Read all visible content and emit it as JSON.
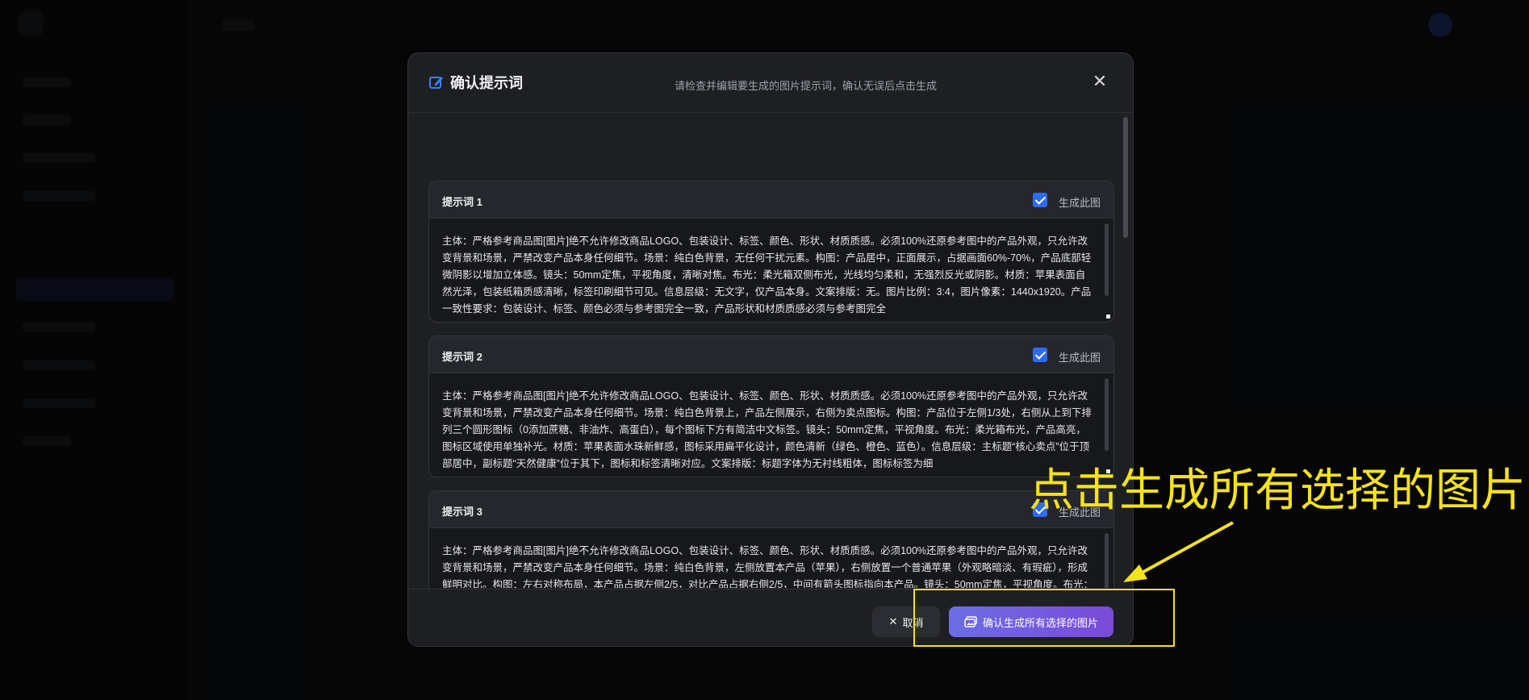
{
  "modal": {
    "title": "确认提示词",
    "subtitle": "请检查并编辑要生成的图片提示词，确认无误后点击生成",
    "close_glyph": "✕"
  },
  "prompts": [
    {
      "title": "提示词 1",
      "checked": true,
      "check_label": "生成此图",
      "text": "主体：严格参考商品图[图片]绝不允许修改商品LOGO、包装设计、标签、颜色、形状、材质质感。必须100%还原参考图中的产品外观，只允许改变背景和场景，严禁改变产品本身任何细节。场景：纯白色背景，无任何干扰元素。构图：产品居中，正面展示，占据画面60%-70%，产品底部轻微阴影以增加立体感。镜头：50mm定焦，平视角度，清晰对焦。布光：柔光箱双侧布光，光线均匀柔和，无强烈反光或阴影。材质：苹果表面自然光泽，包装纸箱质感清晰，标签印刷细节可见。信息层级：无文字，仅产品本身。文案排版：无。图片比例：3:4，图片像素：1440x1920。产品一致性要求：包装设计、标签、颜色必须与参考图完全一致，产品形状和材质质感必须与参考图完全"
    },
    {
      "title": "提示词 2",
      "checked": true,
      "check_label": "生成此图",
      "text": "主体：严格参考商品图[图片]绝不允许修改商品LOGO、包装设计、标签、颜色、形状、材质质感。必须100%还原参考图中的产品外观，只允许改变背景和场景，严禁改变产品本身任何细节。场景：纯白色背景上，产品左侧展示，右侧为卖点图标。构图：产品位于左侧1/3处，右侧从上到下排列三个圆形图标（0添加蔗糖、非油炸、高蛋白），每个图标下方有简洁中文标签。镜头：50mm定焦，平视角度。布光：柔光箱布光，产品高亮，图标区域使用单独补光。材质：苹果表面水珠新鲜感，图标采用扁平化设计，颜色清新（绿色、橙色、蓝色）。信息层级：主标题“核心卖点”位于顶部居中，副标题“天然健康”位于其下，图标和标签清晰对应。文案排版：标题字体为无衬线粗体，图标标签为细"
    },
    {
      "title": "提示词 3",
      "checked": true,
      "check_label": "生成此图",
      "text": "主体：严格参考商品图[图片]绝不允许修改商品LOGO、包装设计、标签、颜色、形状、材质质感。必须100%还原参考图中的产品外观，只允许改变背景和场景，严禁改变产品本身任何细节。场景：纯白色背景，左侧放置本产品（苹果），右侧放置一个普通苹果（外观略暗淡、有瑕疵），形成鲜明对比。构图：左右对称布局，本产品占据左侧2/5，对比产品占据右侧2/5，中间有箭头图标指向本产品。镜头：50mm定焦，平视角度。布光：柔光箱布光，本产品光线更亮、更温暖，对比产品光线较暗、偏冷。材质：本产品表面光泽、颜色鲜艳、无瑕疵；对比产品表面哑光、颜色暗淡、有小斑点。信息层级：顶部标题“为什么选择我们？”，本产品下方标签“新鲜采摘”，对比产品下方标签“普通"
    }
  ],
  "footer": {
    "cancel_icon": "✕",
    "cancel_label": "取消",
    "confirm_label": "确认生成所有选择的图片"
  },
  "annotation": {
    "text": "点击生成所有选择的图片",
    "color": "#f5e21a"
  },
  "colors": {
    "accent": "#2f6bf2",
    "button_gradient_start": "#6c6ee3",
    "button_gradient_end": "#7a4ad8"
  }
}
